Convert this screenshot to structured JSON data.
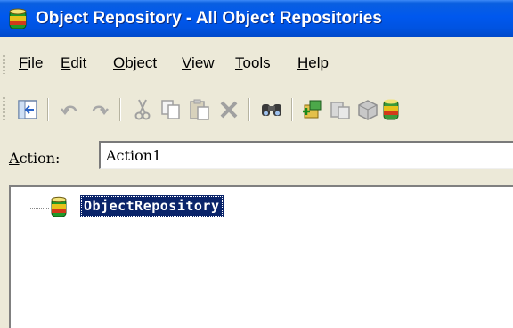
{
  "window": {
    "title": "Object Repository - All Object Repositories",
    "title_icon": "repository-db-icon"
  },
  "menu": {
    "items": [
      {
        "label": "File"
      },
      {
        "label": "Edit"
      },
      {
        "label": "Object"
      },
      {
        "label": "View"
      },
      {
        "label": "Tools"
      },
      {
        "label": "Help"
      }
    ]
  },
  "toolbar": {
    "buttons": [
      {
        "icon": "export-icon"
      },
      {
        "icon": "undo-icon"
      },
      {
        "icon": "redo-icon"
      },
      {
        "icon": "cut-icon"
      },
      {
        "icon": "copy-icon"
      },
      {
        "icon": "paste-icon"
      },
      {
        "icon": "delete-icon"
      },
      {
        "icon": "find-icon"
      },
      {
        "icon": "add-objects-icon"
      },
      {
        "icon": "update-icon"
      },
      {
        "icon": "object-spy-icon"
      },
      {
        "icon": "repository-icon"
      }
    ]
  },
  "action": {
    "label": "Action:",
    "value": "Action1"
  },
  "tree": {
    "root_label": "ObjectRepository",
    "root_icon": "repository-db-icon",
    "selected": true
  },
  "colors": {
    "title_bar": "#0054e3",
    "selection": "#0a246a",
    "window_bg": "#ece9d8"
  }
}
